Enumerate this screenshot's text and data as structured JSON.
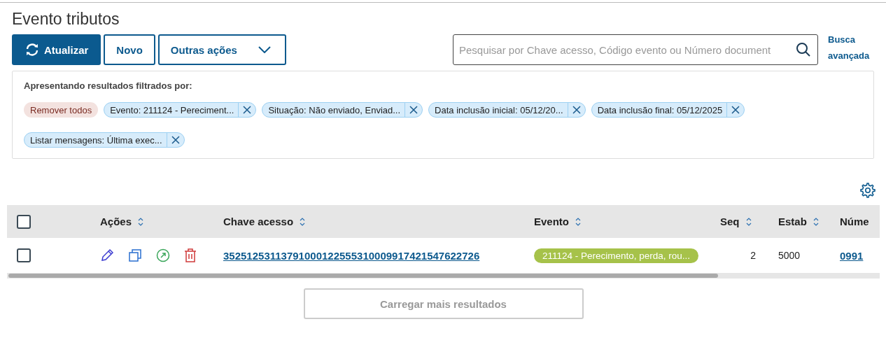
{
  "page": {
    "title": "Evento tributos"
  },
  "actions": [
    {
      "label": "Atualizar",
      "kind": "primary"
    },
    {
      "label": "Novo",
      "kind": "secondary"
    },
    {
      "label": "Outras ações",
      "kind": "dropdown"
    }
  ],
  "search": {
    "placeholder": "Pesquisar por Chave acesso, Código evento ou Número document"
  },
  "advanced_search": "Busca avançada",
  "filters": {
    "caption": "Apresentando resultados filtrados por:",
    "chips": [
      {
        "label": "Remover todos",
        "kind": "remove-all"
      },
      {
        "label": "Evento: 211124 - Pereciment...",
        "kind": "filter"
      },
      {
        "label": "Situação: Não enviado, Enviad...",
        "kind": "filter"
      },
      {
        "label": "Data inclusão inicial: 05/12/20...",
        "kind": "filter"
      },
      {
        "label": "Data inclusão final: 05/12/2025",
        "kind": "filter"
      },
      {
        "label": "Listar mensagens: Última exec...",
        "kind": "filter"
      }
    ]
  },
  "table": {
    "columns": [
      {
        "label": "Ações"
      },
      {
        "label": "Chave acesso"
      },
      {
        "label": "Evento"
      },
      {
        "label": "Seq"
      },
      {
        "label": "Estab"
      },
      {
        "label": "Núme"
      }
    ],
    "header_checked": false,
    "rows": [
      {
        "checked": false,
        "chave": "35251253113791000122555310009917421547622726",
        "evento": {
          "label": "211124 - Perecimento, perda, rou...",
          "color": "#a6c24a"
        },
        "seq": "2",
        "estab": "5000",
        "numero": "0991"
      }
    ]
  },
  "load_more": {
    "label": "Carregar mais resultados",
    "disabled": true
  }
}
